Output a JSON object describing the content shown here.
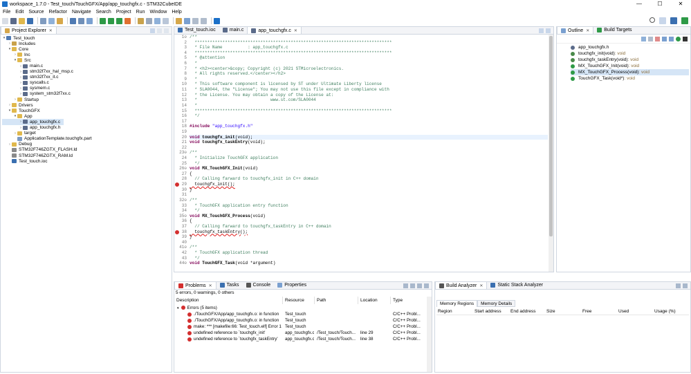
{
  "window": {
    "title": "workspace_1.7.0 - Test_touch/TouchGFX/App/app_touchgfx.c - STM32CubeIDE",
    "min_label": "—",
    "max_label": "☐",
    "close_label": "✕"
  },
  "menu": [
    "File",
    "Edit",
    "Source",
    "Refactor",
    "Navigate",
    "Search",
    "Project",
    "Run",
    "Window",
    "Help"
  ],
  "project_explorer": {
    "tab_label": "Project Explorer",
    "tree": [
      {
        "label": "Test_touch",
        "indent": 0,
        "arrow": "▾",
        "color": "#4f7ab3"
      },
      {
        "label": "Includes",
        "indent": 1,
        "arrow": "›",
        "color": "#c9a24b"
      },
      {
        "label": "Core",
        "indent": 1,
        "arrow": "▾",
        "color": "#e0b84c"
      },
      {
        "label": "Inc",
        "indent": 2,
        "arrow": "›",
        "color": "#e0b84c"
      },
      {
        "label": "Src",
        "indent": 2,
        "arrow": "▾",
        "color": "#e0b84c"
      },
      {
        "label": "main.c",
        "indent": 3,
        "arrow": "›",
        "color": "#5b6b8a"
      },
      {
        "label": "stm32f7xx_hal_msp.c",
        "indent": 3,
        "arrow": "›",
        "color": "#5b6b8a"
      },
      {
        "label": "stm32f7xx_it.c",
        "indent": 3,
        "arrow": "›",
        "color": "#5b6b8a"
      },
      {
        "label": "syscalls.c",
        "indent": 3,
        "arrow": "›",
        "color": "#5b6b8a"
      },
      {
        "label": "sysmem.c",
        "indent": 3,
        "arrow": "›",
        "color": "#5b6b8a"
      },
      {
        "label": "system_stm32f7xx.c",
        "indent": 3,
        "arrow": "›",
        "color": "#5b6b8a"
      },
      {
        "label": "Startup",
        "indent": 2,
        "arrow": "›",
        "color": "#e0b84c"
      },
      {
        "label": "Drivers",
        "indent": 1,
        "arrow": "›",
        "color": "#e0b84c"
      },
      {
        "label": "TouchGFX",
        "indent": 1,
        "arrow": "▾",
        "color": "#e0b84c"
      },
      {
        "label": "App",
        "indent": 2,
        "arrow": "▾",
        "color": "#e0b84c"
      },
      {
        "label": "app_touchgfx.c",
        "indent": 3,
        "arrow": "›",
        "color": "#5b6b8a",
        "selected": true
      },
      {
        "label": "app_touchgfx.h",
        "indent": 3,
        "arrow": "›",
        "color": "#5b6b8a"
      },
      {
        "label": "target",
        "indent": 2,
        "arrow": "›",
        "color": "#e0b84c"
      },
      {
        "label": "ApplicationTemplate.touchgfx.part",
        "indent": 2,
        "arrow": "",
        "color": "#7c9ac2"
      },
      {
        "label": "Debug",
        "indent": 1,
        "arrow": "›",
        "color": "#e0b84c"
      },
      {
        "label": "STM32F746ZGTX_FLASH.ld",
        "indent": 1,
        "arrow": "",
        "color": "#8a8a8a"
      },
      {
        "label": "STM32F746ZGTX_RAM.ld",
        "indent": 1,
        "arrow": "",
        "color": "#8a8a8a"
      },
      {
        "label": "Test_touch.ioc",
        "indent": 1,
        "arrow": "",
        "color": "#3a6fb0"
      }
    ]
  },
  "editor": {
    "tabs": [
      {
        "label": "Test_touch.ioc",
        "active": false,
        "color": "#3a6fb0"
      },
      {
        "label": "main.c",
        "active": false,
        "color": "#5b6b8a"
      },
      {
        "label": "app_touchgfx.c",
        "active": true,
        "color": "#5b6b8a"
      }
    ],
    "lines": [
      {
        "n": "1⊖",
        "t": "/**",
        "c": "cm"
      },
      {
        "n": "2",
        "t": "  ******************************************************************************",
        "c": "cm"
      },
      {
        "n": "3",
        "t": "  * File Name          : app_touchgfx.c",
        "c": "cm"
      },
      {
        "n": "4",
        "t": "  ******************************************************************************",
        "c": "cm"
      },
      {
        "n": "5",
        "t": "  * @attention",
        "c": "cm"
      },
      {
        "n": "6",
        "t": "  *",
        "c": "cm"
      },
      {
        "n": "7",
        "t": "  * <h2><center>&copy; Copyright (c) 2021 STMicroelectronics.",
        "c": "cm"
      },
      {
        "n": "8",
        "t": "  * All rights reserved.</center></h2>",
        "c": "cm"
      },
      {
        "n": "9",
        "t": "  *",
        "c": "cm"
      },
      {
        "n": "10",
        "t": "  * This software component is licensed by ST under Ultimate Liberty license",
        "c": "cm"
      },
      {
        "n": "11",
        "t": "  * SLA0044, the \"License\"; You may not use this file except in compliance with",
        "c": "cm"
      },
      {
        "n": "12",
        "t": "  * the License. You may obtain a copy of the License at:",
        "c": "cm"
      },
      {
        "n": "13",
        "t": "  *                             www.st.com/SLA0044",
        "c": "cm"
      },
      {
        "n": "14",
        "t": "  *",
        "c": "cm"
      },
      {
        "n": "15",
        "t": "  ******************************************************************************",
        "c": "cm"
      },
      {
        "n": "16",
        "t": "  */",
        "c": "cm"
      },
      {
        "n": "17",
        "t": "",
        "c": ""
      },
      {
        "n": "18",
        "t": "",
        "c": "inc",
        "kw": "#include ",
        "s": "\"app_touchgfx.h\""
      },
      {
        "n": "19",
        "t": "",
        "c": ""
      },
      {
        "n": "20",
        "t": "",
        "c": "decl hl",
        "kw": "void ",
        "b": "touchgfx_init",
        "r": "(void);"
      },
      {
        "n": "21",
        "t": "",
        "c": "decl",
        "kw": "void ",
        "b": "touchgfx_taskEntry",
        "r": "(void);"
      },
      {
        "n": "22",
        "t": "",
        "c": ""
      },
      {
        "n": "23⊖",
        "t": "/**",
        "c": "cm"
      },
      {
        "n": "24",
        "t": "  * Initialize TouchGFX application",
        "c": "cm"
      },
      {
        "n": "25",
        "t": "  */",
        "c": "cm"
      },
      {
        "n": "26⊖",
        "t": "",
        "c": "decl",
        "kw": "void ",
        "b": "MX_TouchGFX_Init",
        "r": "(void)"
      },
      {
        "n": "27",
        "t": "{",
        "c": ""
      },
      {
        "n": "28",
        "t": "  // Calling farward to touchgfx_init in C++ domain",
        "c": "cm"
      },
      {
        "n": "29",
        "t": "  touchgfx_init();",
        "c": "errline",
        "err": true
      },
      {
        "n": "30",
        "t": "}",
        "c": ""
      },
      {
        "n": "31",
        "t": "",
        "c": ""
      },
      {
        "n": "32⊖",
        "t": "/**",
        "c": "cm"
      },
      {
        "n": "33",
        "t": "  * TouchGFX application entry function",
        "c": "cm"
      },
      {
        "n": "34",
        "t": "  */",
        "c": "cm"
      },
      {
        "n": "35⊖",
        "t": "",
        "c": "decl",
        "kw": "void ",
        "b": "MX_TouchGFX_Process",
        "r": "(void)"
      },
      {
        "n": "36",
        "t": "{",
        "c": ""
      },
      {
        "n": "37",
        "t": "  // Calling farward to touchgfx_taskEntry in C++ domain",
        "c": "cm"
      },
      {
        "n": "38",
        "t": "  touchgfx_taskEntry();",
        "c": "errline",
        "err": true
      },
      {
        "n": "39",
        "t": "}",
        "c": ""
      },
      {
        "n": "40",
        "t": "",
        "c": ""
      },
      {
        "n": "41⊖",
        "t": "/**",
        "c": "cm"
      },
      {
        "n": "42",
        "t": "  * TouchGFX application thread",
        "c": "cm"
      },
      {
        "n": "43",
        "t": "  */",
        "c": "cm"
      },
      {
        "n": "44⊖",
        "t": "",
        "c": "decl",
        "kw": "void ",
        "b": "TouchGFX_Task",
        "r": "(void *argument)"
      }
    ]
  },
  "outline": {
    "tabs": [
      "Outline",
      "Build Targets"
    ],
    "items": [
      {
        "label": "app_touchgfx.h",
        "type": "",
        "color": "#5b6b8a"
      },
      {
        "label": "touchgfx_init(void)",
        "type": " : void",
        "color": "#4a8a4a"
      },
      {
        "label": "touchgfx_taskEntry(void)",
        "type": " : void",
        "color": "#4a8a4a"
      },
      {
        "label": "MX_TouchGFX_Init(void)",
        "type": " : void",
        "color": "#2e9a47"
      },
      {
        "label": "MX_TouchGFX_Process(void)",
        "type": " : void",
        "color": "#2e9a47",
        "selected": true
      },
      {
        "label": "TouchGFX_Task(void*)",
        "type": " : void",
        "color": "#2e9a47"
      }
    ]
  },
  "problems": {
    "tabs": [
      "Problems",
      "Tasks",
      "Console",
      "Properties"
    ],
    "summary": "5 errors, 0 warnings, 0 others",
    "columns": [
      "Description",
      "Resource",
      "Path",
      "Location",
      "Type"
    ],
    "group_label": "Errors (5 items)",
    "rows": [
      {
        "desc": "./TouchGFX/App/app_touchgfx.o: in function",
        "res": "Test_touch",
        "path": "",
        "loc": "",
        "type": "C/C++ Probl..."
      },
      {
        "desc": "./TouchGFX/App/app_touchgfx.o: in function",
        "res": "Test_touch",
        "path": "",
        "loc": "",
        "type": "C/C++ Probl..."
      },
      {
        "desc": "make: *** [makefile:66: Test_touch.elf] Error 1",
        "res": "Test_touch",
        "path": "",
        "loc": "",
        "type": "C/C++ Probl..."
      },
      {
        "desc": "undefined reference to `touchgfx_init'",
        "res": "app_touchgfx.c",
        "path": "/Test_touch/Touch...",
        "loc": "line 29",
        "type": "C/C++ Probl..."
      },
      {
        "desc": "undefined reference to `touchgfx_taskEntry'",
        "res": "app_touchgfx.c",
        "path": "/Test_touch/Touch...",
        "loc": "line 38",
        "type": "C/C++ Probl..."
      }
    ]
  },
  "build_analyzer": {
    "tabs": [
      "Build Analyzer",
      "Static Stack Analyzer"
    ],
    "subtabs": [
      "Memory Regions",
      "Memory Details"
    ],
    "columns": [
      "Region",
      "Start address",
      "End address",
      "Size",
      "Free",
      "Used",
      "Usage (%)"
    ]
  }
}
